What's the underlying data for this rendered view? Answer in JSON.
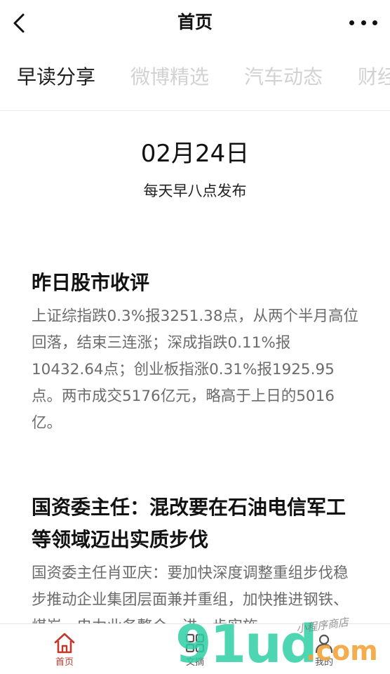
{
  "nav": {
    "title": "首页",
    "back_icon": "chevron-left-icon",
    "more_icon": "more-dots-icon"
  },
  "tabs": [
    {
      "label": "早读分享",
      "active": true
    },
    {
      "label": "微博精选",
      "active": false
    },
    {
      "label": "汽车动态",
      "active": false
    },
    {
      "label": "财经",
      "active": false
    }
  ],
  "header": {
    "date": "02月24日",
    "subtitle": "每天早八点发布"
  },
  "articles": [
    {
      "title": "昨日股市收评",
      "body": "上证综指跌0.3%报3251.38点，从两个半月高位回落，结束三连涨；深成指跌0.11%报10432.64点；创业板指涨0.31%报1925.95点。两市成交5176亿元，略高于上日的5016亿。"
    },
    {
      "title": "国资委主任：混改要在石油电信军工等领域迈出实质步伐",
      "body": "国资委主任肖亚庆：要加快深度调整重组步伐稳步推动企业集团层面兼并重组，加快推进钢铁、煤炭、电力业务整合，进一步实施"
    }
  ],
  "tabbar": [
    {
      "label": "首页",
      "icon": "home-icon",
      "active": true
    },
    {
      "label": "文摘",
      "icon": "grid-icon",
      "active": false
    },
    {
      "label": "我的",
      "icon": "user-icon",
      "active": false
    }
  ],
  "watermark": {
    "main": "91ud",
    "suffix": ".com",
    "small": "小程序商店"
  },
  "colors": {
    "accent": "#c0392b",
    "tab_inactive": "#d2d2d2",
    "body_text": "#6b6b6b",
    "watermark_green": "#2fcfa4",
    "watermark_orange": "#f3a43a"
  }
}
